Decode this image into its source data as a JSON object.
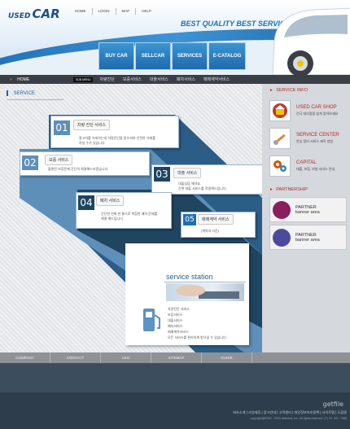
{
  "brand": {
    "logo_small": "USED",
    "logo_big": "CAR"
  },
  "top_links": [
    "HOME",
    "LOGIN",
    "MAP",
    "HELP"
  ],
  "slogan": "BEST QUALITY BEST SERVICE",
  "main_nav": [
    "BUY CAR",
    "SELLCAR",
    "SERVICES",
    "E-CATALOG"
  ],
  "sub_nav": {
    "home": "HOME",
    "tag": "SUB MENU",
    "items": [
      "차량진단",
      "보증서비스",
      "대출서비스",
      "폐차서비스",
      "매매계약서비스"
    ]
  },
  "page_title": "SERVICE",
  "cards": [
    {
      "num": "01",
      "title": "차량 진단 서비스",
      "desc": [
        "중고차를 거래하는데 차량진단을 받으셔야 안전한 거래를",
        "하실 수가 있습니다."
      ]
    },
    {
      "num": "02",
      "title": "보증 서비스",
      "desc": [
        "불편된 보증문제 간단히 해결해드리겠습니다."
      ]
    },
    {
      "num": "03",
      "title": "대출 서비스",
      "desc": [
        "대출상담 해야죠.",
        "간편 대출 서비스를 적용해드립니다."
      ]
    },
    {
      "num": "04",
      "title": "폐차 서비스",
      "desc": [
        "간단한 전화 한 통으로 복잡한 폐차 문제를",
        "해결 해드립니다."
      ]
    },
    {
      "num": "05",
      "title": "매매계약 서비스",
      "desc": [
        "(계약서 다운)"
      ]
    }
  ],
  "service_station": {
    "title": "service station",
    "list": [
      "차량진단 서비스",
      "보증서비스",
      "대출서비스",
      "폐차서비스",
      "매매계약서비스",
      "모든 서비스를 편리하게 받으실 수 있습니다."
    ]
  },
  "sidebar": {
    "info_title": "SERVICE INFO",
    "items": [
      {
        "icon": "shop-icon",
        "title": "USED CAR SHOP",
        "desc": "전국 대리점을 쉽게 찾아보세요"
      },
      {
        "icon": "wrench-icon",
        "title": "SERVICE CENTER",
        "desc": "안심 정비 서비스 제작 방법"
      },
      {
        "icon": "gears-icon",
        "title": "CAPITAL",
        "desc": "대출, 보증, 보험 서비스 안내"
      }
    ],
    "partner_title": "PARTNERSHIP",
    "partners": [
      {
        "icon": "globe-icon",
        "name": "PARTNER",
        "sub": "banner area",
        "color": "#8b1f5d"
      },
      {
        "icon": "car-badge-icon",
        "name": "PARTNER",
        "sub": "banner area",
        "color": "#4c4a9e"
      }
    ]
  },
  "footer_nav": [
    "COMPANY",
    "CONTACT",
    "CEO",
    "SITEMAP",
    "GUIDE"
  ],
  "footer": {
    "logo": "getfile",
    "links": "회사소개 | 사업제휴 | 광고안내 | 고객센터 | 개인정보보호정책 | 사이트맵 | 도움말",
    "copyright": "copyright@2002 - 2003 vitamind, Inc.  All rights reserved. (T) 02. 541. 7486"
  },
  "colors": {
    "accent": "#1f6fb2",
    "dark_nav": "#3a3f46",
    "red": "#b32a2a"
  }
}
